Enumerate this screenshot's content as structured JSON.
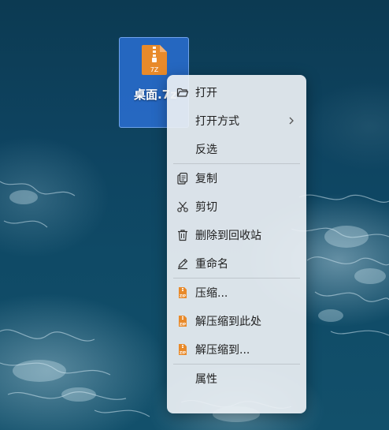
{
  "desktop": {
    "file": {
      "name": "桌面.7z",
      "badge": "7Z"
    }
  },
  "context_menu": {
    "groups": [
      [
        {
          "label": "打开",
          "icon": "folder-open-icon"
        },
        {
          "label": "打开方式",
          "icon": "",
          "submenu": true
        },
        {
          "label": "反选",
          "icon": ""
        }
      ],
      [
        {
          "label": "复制",
          "icon": "copy-icon"
        },
        {
          "label": "剪切",
          "icon": "scissors-icon"
        },
        {
          "label": "删除到回收站",
          "icon": "trash-icon"
        },
        {
          "label": "重命名",
          "icon": "pencil-icon"
        }
      ],
      [
        {
          "label": "压缩...",
          "icon": "zip-archive-icon"
        },
        {
          "label": "解压缩到此处",
          "icon": "zip-archive-icon"
        },
        {
          "label": "解压缩到...",
          "icon": "zip-archive-icon"
        }
      ],
      [
        {
          "label": "属性",
          "icon": ""
        }
      ]
    ]
  },
  "colors": {
    "selection_blue": "#2a6ed2",
    "archive_orange": "#e88a2a",
    "menu_bg": "#ecf0f4"
  }
}
